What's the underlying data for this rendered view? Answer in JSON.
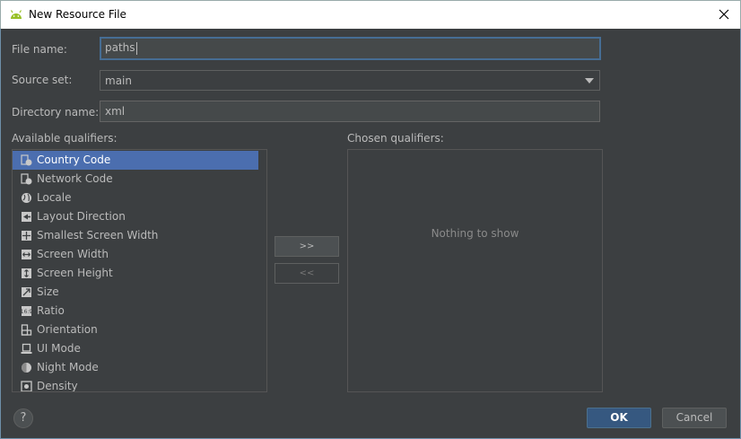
{
  "window": {
    "title": "New Resource File",
    "icon": "android-icon",
    "close_icon": "close-icon"
  },
  "form": {
    "file_name": {
      "label": "File name:",
      "value": "paths"
    },
    "source_set": {
      "label": "Source set:",
      "value": "main"
    },
    "directory_name": {
      "label": "Directory name:",
      "value": "xml"
    }
  },
  "qualifiers": {
    "available_label": "Available qualifiers:",
    "chosen_label": "Chosen qualifiers:",
    "items": [
      {
        "label": "Country Code",
        "icon": "country-code-icon",
        "selected": true
      },
      {
        "label": "Network Code",
        "icon": "network-code-icon"
      },
      {
        "label": "Locale",
        "icon": "globe-icon"
      },
      {
        "label": "Layout Direction",
        "icon": "layout-direction-icon"
      },
      {
        "label": "Smallest Screen Width",
        "icon": "smallest-screen-width-icon"
      },
      {
        "label": "Screen Width",
        "icon": "screen-width-icon"
      },
      {
        "label": "Screen Height",
        "icon": "screen-height-icon"
      },
      {
        "label": "Size",
        "icon": "size-icon"
      },
      {
        "label": "Ratio",
        "icon": "ratio-icon"
      },
      {
        "label": "Orientation",
        "icon": "orientation-icon"
      },
      {
        "label": "UI Mode",
        "icon": "ui-mode-icon"
      },
      {
        "label": "Night Mode",
        "icon": "night-mode-icon"
      },
      {
        "label": "Density",
        "icon": "density-icon"
      }
    ],
    "add_button": ">>",
    "remove_button": "<<",
    "empty_text": "Nothing to show"
  },
  "footer": {
    "help": "?",
    "ok": "OK",
    "cancel": "Cancel"
  },
  "colors": {
    "background": "#3c3f41",
    "selection": "#4b6eaf",
    "ok_button": "#365880",
    "focus_border": "#466d94"
  }
}
